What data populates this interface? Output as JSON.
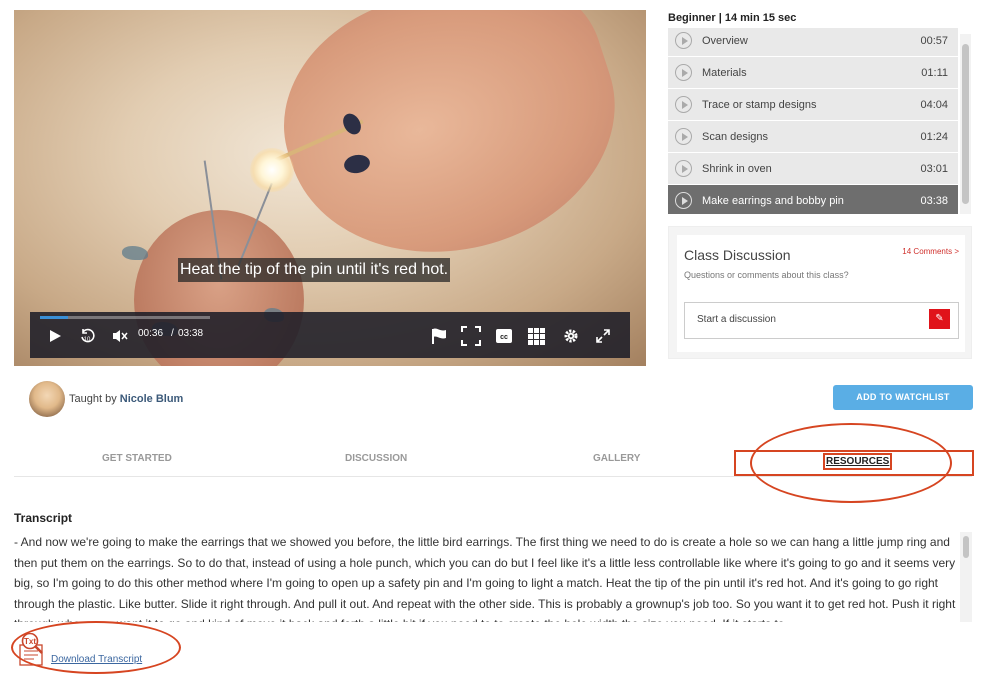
{
  "video": {
    "caption": "Heat the tip of the pin until it's red hot.",
    "current_time": "00:36",
    "separator": "/",
    "duration": "03:38",
    "progress": 0.165
  },
  "course": {
    "level": "Beginner | 14 min 15 sec",
    "lessons": [
      {
        "title": "Overview",
        "duration": "00:57"
      },
      {
        "title": "Materials",
        "duration": "01:11"
      },
      {
        "title": "Trace or stamp designs",
        "duration": "04:04"
      },
      {
        "title": "Scan designs",
        "duration": "01:24"
      },
      {
        "title": "Shrink in oven",
        "duration": "03:01"
      },
      {
        "title": "Make earrings and bobby pin",
        "duration": "03:38",
        "active": true
      }
    ]
  },
  "discussion": {
    "title": "Class Discussion",
    "subtitle": "Questions or comments about this class?",
    "comments_link": "14 Comments >",
    "input_placeholder": "Start a discussion"
  },
  "teacher": {
    "prefix": "Taught by",
    "name": "Nicole Blum"
  },
  "watchlist_button": "ADD TO WATCHLIST",
  "tabs": [
    {
      "label": "GET STARTED"
    },
    {
      "label": "DISCUSSION"
    },
    {
      "label": "GALLERY"
    },
    {
      "label": "RESOURCES",
      "active": true
    }
  ],
  "transcript": {
    "title": "Transcript",
    "text": "- And now we're going to make the earrings that we showed you before, the little bird earrings. The first thing we need to do is create a hole so we can hang a little jump ring and then put them on the earrings. So to do that, instead of using a hole punch, which you can do but I feel like it's a little less controllable like where it's going to go and it seems very big, so I'm going to do this other method where I'm going to open up a safety pin and I'm going to light a match. Heat the tip of the pin until it's red hot. And it's going to go right through the plastic. Like butter. Slide it right through. And pull it out. And repeat with the other side. This is probably a grownup's job too. So you want it to get red hot. Push it right through where you want it to go and kind of move it back and forth a little bit if you need to to create the hole width the size you need. If it starts to",
    "download_label": "Download Transcript",
    "icon_text": "Txt"
  },
  "colors": {
    "accent_blue": "#5aaee5",
    "highlight_red": "#d64521",
    "comment_red": "#d0312d",
    "active_lesson": "#6e6e6e"
  }
}
